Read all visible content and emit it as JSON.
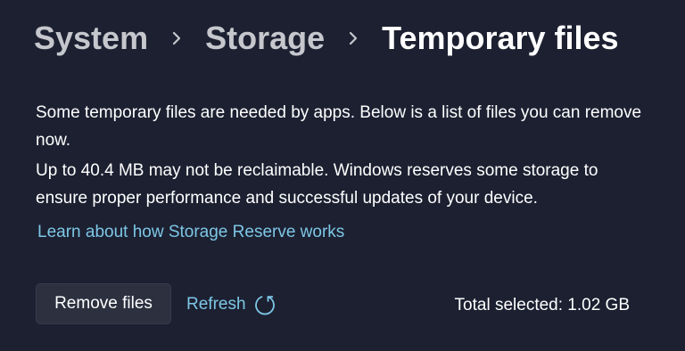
{
  "breadcrumb": {
    "items": [
      {
        "label": "System"
      },
      {
        "label": "Storage"
      },
      {
        "label": "Temporary files"
      }
    ]
  },
  "content": {
    "intro": "Some temporary files are needed by apps. Below is a list of files you can remove now.",
    "reserve_note": "Up to 40.4 MB may not be reclaimable. Windows reserves some storage to ensure proper performance and successful updates of your device.",
    "learn_link": "Learn about how Storage Reserve works"
  },
  "actions": {
    "remove_label": "Remove files",
    "refresh_label": "Refresh",
    "refresh_icon": "refresh-icon"
  },
  "summary": {
    "total_selected": "Total selected: 1.02 GB"
  },
  "colors": {
    "background": "#1c2031",
    "accent_link": "#7ec7e6",
    "button_bg": "#2c303f"
  }
}
